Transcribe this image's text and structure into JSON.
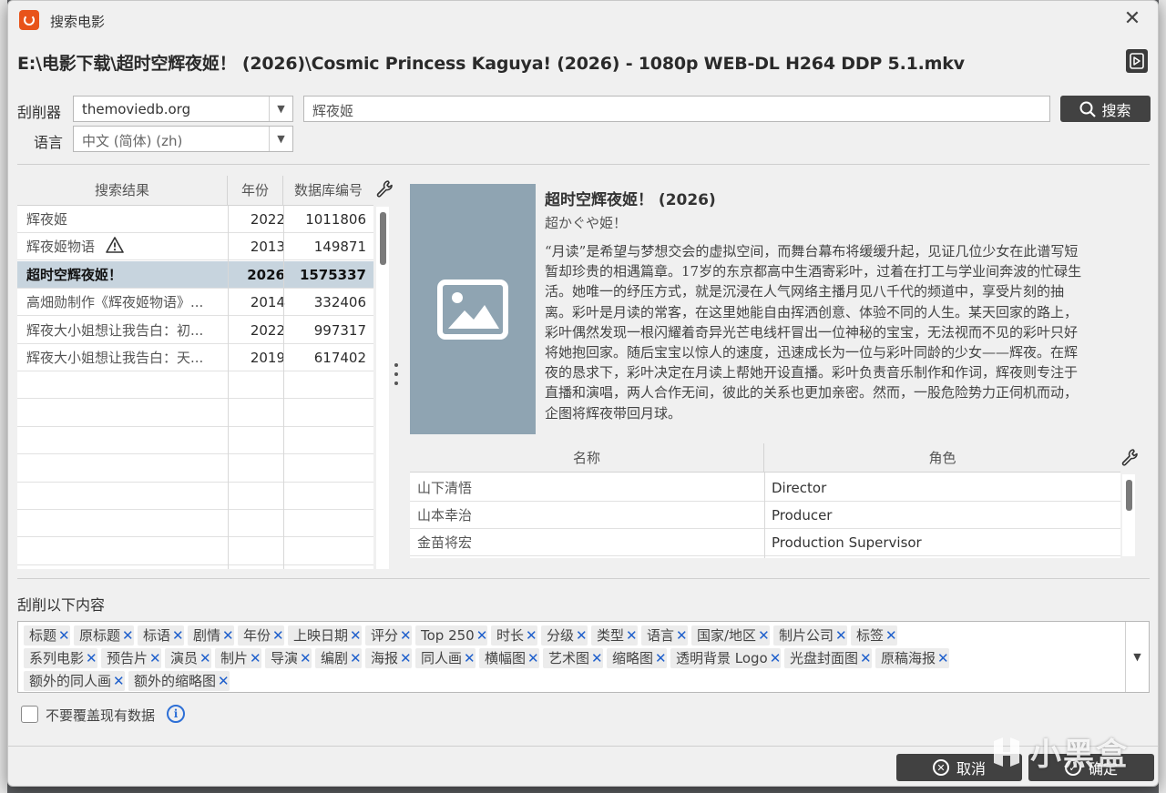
{
  "window": {
    "title": "搜索电影",
    "filepath": "E:\\电影下载\\超时空辉夜姬！ (2026)\\Cosmic Princess Kaguya! (2026) - 1080p WEB-DL H264 DDP 5.1.mkv"
  },
  "search": {
    "scraper_label": "刮削器",
    "scraper_value": "themoviedb.org",
    "query": "辉夜姬",
    "button_label": "搜索",
    "language_label": "语言",
    "language_value": "中文 (简体) (zh)"
  },
  "results": {
    "columns": [
      "搜索结果",
      "年份",
      "数据库编号"
    ],
    "rows": [
      {
        "name": "辉夜姬",
        "year": "2022",
        "id": "1011806"
      },
      {
        "name": "辉夜姬物语",
        "year": "2013",
        "id": "149871",
        "warning": true
      },
      {
        "name": "超时空辉夜姬！",
        "year": "2026",
        "id": "1575337",
        "selected": true
      },
      {
        "name": "高畑勋制作《辉夜姬物语》...",
        "year": "2014",
        "id": "332406"
      },
      {
        "name": "辉夜大小姐想让我告白：初...",
        "year": "2022",
        "id": "997317"
      },
      {
        "name": "辉夜大小姐想让我告白：天...",
        "year": "2019",
        "id": "617402"
      }
    ]
  },
  "detail": {
    "title": "超时空辉夜姬！ (2026)",
    "original_title": "超かぐや姫！",
    "overview_lines": [
      "“月读”是希望与梦想交会的虚拟空间，而舞台幕布将缓缓升起，见证几位少女在此谱写短",
      "暂却珍贵的相遇篇章。17岁的东京都高中生酒寄彩叶，过着在打工与学业间奔波的忙碌生",
      "活。她唯一的纾压方式，就是沉浸在人气网络主播月见八千代的频道中，享受片刻的抽",
      "离。彩叶是月读的常客，在这里她能自由挥洒创意、体验不同的人生。某天回家的路上，",
      "彩叶偶然发现一根闪耀着奇异光芒电线杆冒出一位神秘的宝宝，无法视而不见的彩叶只好",
      "将她抱回家。随后宝宝以惊人的速度，迅速成长为一位与彩叶同龄的少女——辉夜。在辉",
      "夜的恳求下，彩叶决定在月读上帮她开设直播。彩叶负责音乐制作和作词，辉夜则专注于",
      "直播和演唱，两人合作无间，彼此的关系也更加亲密。然而，一股危险势力正伺机而动，",
      "企图将辉夜带回月球。"
    ],
    "cast_columns": [
      "名称",
      "角色"
    ],
    "cast": [
      {
        "name": "山下清悟",
        "role": "Director"
      },
      {
        "name": "山本幸治",
        "role": "Producer"
      },
      {
        "name": "金苗将宏",
        "role": "Production Supervisor"
      }
    ]
  },
  "scrape": {
    "label": "刮削以下内容",
    "tags": [
      "标题",
      "原标题",
      "标语",
      "剧情",
      "年份",
      "上映日期",
      "评分",
      "Top 250",
      "时长",
      "分级",
      "类型",
      "语言",
      "国家/地区",
      "制片公司",
      "标签",
      "系列电影",
      "预告片",
      "演员",
      "制片",
      "导演",
      "编剧",
      "海报",
      "同人画",
      "横幅图",
      "艺术图",
      "缩略图",
      "透明背景 Logo",
      "光盘封面图",
      "原稿海报",
      "额外的同人画",
      "额外的缩略图"
    ],
    "no_overwrite_label": "不要覆盖现有数据"
  },
  "footer": {
    "cancel_label": "取消",
    "ok_label": "确定"
  },
  "watermark": "小黑盒",
  "colors": {
    "accent_orange": "#e8531a",
    "selected_row": "#c7d4de",
    "poster_placeholder": "#8fa4b2",
    "tag_remove": "#1e5fcc",
    "dark_button": "#424242"
  }
}
